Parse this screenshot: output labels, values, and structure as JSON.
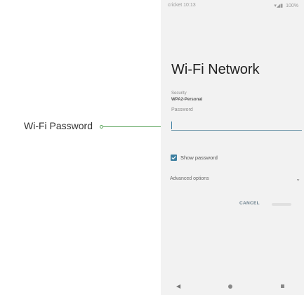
{
  "callout": {
    "label": "Wi-Fi Password",
    "color": "#5aa35a"
  },
  "status_bar": {
    "carrier_time": "cricket 10:13",
    "battery": "100%",
    "icons": "wifi-icon signal-icon battery-icon"
  },
  "dialog": {
    "title": "Wi-Fi Network",
    "security_label": "Security",
    "security_value": "WPA2-Personal",
    "password_label": "Password",
    "password_value": "",
    "show_password": {
      "label": "Show password",
      "checked": true
    },
    "advanced_options_label": "Advanced options",
    "cancel_label": "CANCEL",
    "accent": "#3d7fa0"
  },
  "nav": {
    "back_icon": "back-icon",
    "home_icon": "home-icon",
    "recents_icon": "recents-icon"
  }
}
